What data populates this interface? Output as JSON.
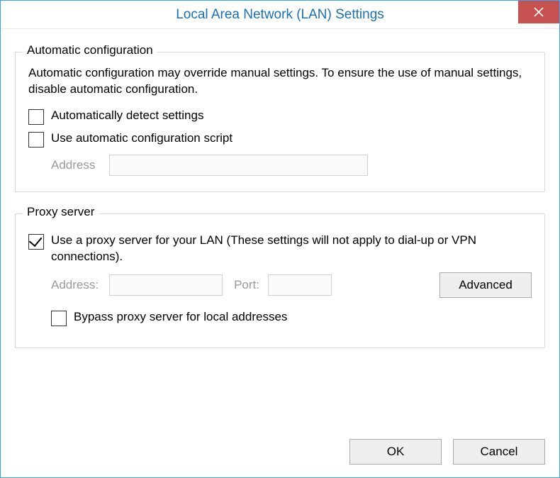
{
  "window": {
    "title": "Local Area Network (LAN) Settings"
  },
  "auto_config": {
    "group_title": "Automatic configuration",
    "info": "Automatic configuration may override manual settings.  To ensure the use of manual settings, disable automatic configuration.",
    "detect_label": "Automatically detect settings",
    "detect_checked": false,
    "script_label": "Use automatic configuration script",
    "script_checked": false,
    "address_label": "Address",
    "address_value": ""
  },
  "proxy": {
    "group_title": "Proxy server",
    "use_proxy_label": "Use a proxy server for your LAN (These settings will not apply to dial-up or VPN connections).",
    "use_proxy_checked": true,
    "address_label": "Address:",
    "address_value": "",
    "port_label": "Port:",
    "port_value": "",
    "advanced_label": "Advanced",
    "bypass_label": "Bypass proxy server for local addresses",
    "bypass_checked": false
  },
  "buttons": {
    "ok": "OK",
    "cancel": "Cancel"
  }
}
